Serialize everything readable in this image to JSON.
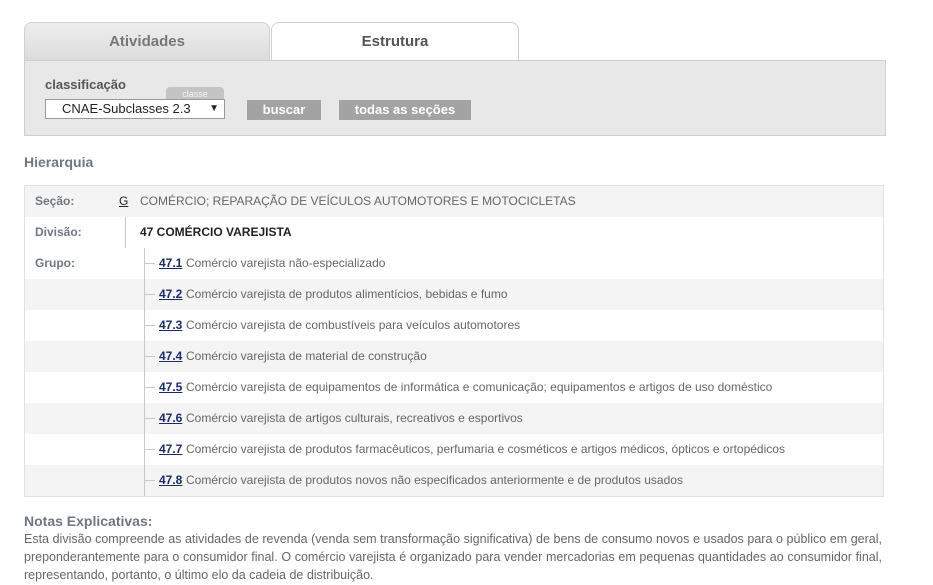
{
  "tabs": {
    "atividades": "Atividades",
    "estrutura": "Estrutura"
  },
  "search": {
    "label": "classificação",
    "tag": "classe",
    "select_value": "CNAE-Subclasses 2.3",
    "buscar": "buscar",
    "todas": "todas as seções"
  },
  "hierarquia": {
    "title": "Hierarquia",
    "secao_label": "Seção:",
    "secao_code": "G",
    "secao_text": "COMÉRCIO; REPARAÇÃO DE VEÍCULOS AUTOMOTORES E MOTOCICLETAS",
    "divisao_label": "Divisão:",
    "divisao_text": "47 COMÉRCIO VAREJISTA",
    "grupo_label": "Grupo:",
    "grupos": [
      {
        "code": "47.1",
        "text": "Comércio varejista não-especializado"
      },
      {
        "code": "47.2",
        "text": "Comércio varejista de produtos alimentícios, bebidas e fumo"
      },
      {
        "code": "47.3",
        "text": "Comércio varejista de combustíveis para veículos automotores"
      },
      {
        "code": "47.4",
        "text": "Comércio varejista de material de construção"
      },
      {
        "code": "47.5",
        "text": "Comércio varejista de equipamentos de informática e comunicação; equipamentos e artigos de uso doméstico"
      },
      {
        "code": "47.6",
        "text": "Comércio varejista de artigos culturais, recreativos e esportivos"
      },
      {
        "code": "47.7",
        "text": "Comércio varejista de produtos farmacêuticos, perfumaria e cosméticos e artigos médicos, ópticos e ortopédicos"
      },
      {
        "code": "47.8",
        "text": "Comércio varejista de produtos novos não especificados anteriormente e de produtos usados"
      }
    ]
  },
  "notes": {
    "title": "Notas Explicativas:",
    "body": "Esta divisão compreende as atividades de revenda (venda sem transformação significativa) de bens de consumo novos e usados para o público em geral, preponderantemente para o consumidor final. O comércio varejista é organizado para vender mercadorias em pequenas quantidades ao consumidor final, representando, portanto, o último elo da cadeia de distribuição."
  }
}
